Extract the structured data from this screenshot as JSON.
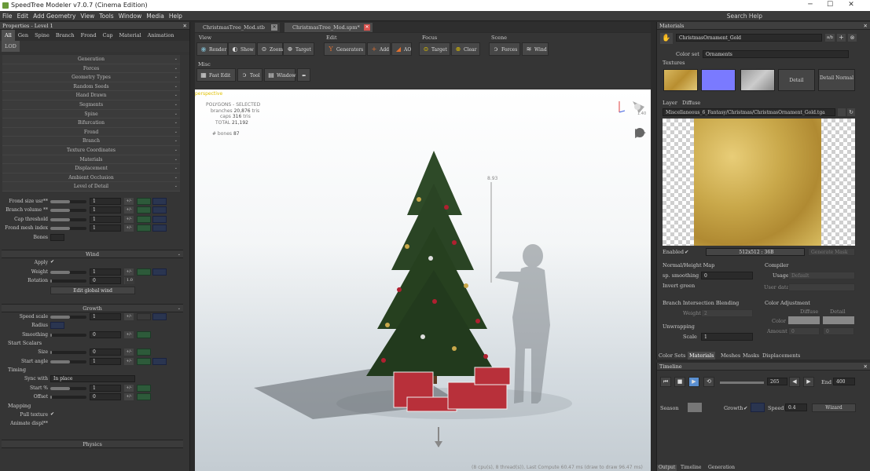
{
  "window": {
    "title": "SpeedTree Modeler v7.0.7 (Cinema Edition)",
    "min": "─",
    "max": "☐",
    "close": "✕"
  },
  "menu": [
    "File",
    "Edit",
    "Add Geometry",
    "View",
    "Tools",
    "Window",
    "Media",
    "Help"
  ],
  "search_help": "Search Help",
  "properties": {
    "title": "Properties - Level 1",
    "tabs": [
      "All",
      "Gen",
      "Spine",
      "Branch",
      "Frond",
      "Cap",
      "Material",
      "Animation"
    ],
    "lod_tab": "LOD",
    "sections": [
      "Generation",
      "Forces",
      "Geometry Types",
      "Random Seeds",
      "Hand Drawn",
      "Segments",
      "Spine",
      "Bifurcation",
      "Frond",
      "Branch",
      "Texture Coordinates",
      "Materials",
      "Displacement",
      "Ambient Occlusion",
      "Level of Detail"
    ],
    "lod_rows": [
      {
        "label": "Frond size usr**",
        "value": "1"
      },
      {
        "label": "Branch volume **",
        "value": "1"
      },
      {
        "label": "Cap threshold",
        "value": "1"
      },
      {
        "label": "Frond mesh index",
        "value": "1"
      }
    ],
    "bones_label": "Bones",
    "wind": {
      "header": "Wind",
      "apply_label": "Apply",
      "apply_check": "✔",
      "weight_label": "Weight",
      "weight": "1",
      "rotation_label": "Rotation",
      "rotation": "0",
      "rotation_max": "1.0",
      "edit_button": "Edit global wind"
    },
    "growth": {
      "header": "Growth",
      "speed_label": "Speed scale",
      "speed": "1",
      "radius_label": "Radius",
      "smoothing_label": "Smoothing",
      "smoothing": "0",
      "start_scalars": "Start Scalars",
      "size_label": "Size",
      "size": "0",
      "angle_label": "Start angle",
      "angle": "1",
      "timing": "Timing",
      "sync_label": "Sync with",
      "sync_value": "In place",
      "startk_label": "Start %",
      "startk": "1",
      "offset_label": "Offset",
      "offset": "0",
      "mapping": "Mapping",
      "pull_label": "Pull texture",
      "pull_check": "✔",
      "animate_label": "Animate displ**"
    },
    "physics": "Physics"
  },
  "doc_tabs": [
    {
      "label": "ChristmasTree_Mod.stb",
      "close": "✕"
    },
    {
      "label": "ChristmasTree_Mod.spm*",
      "close": "✕"
    }
  ],
  "toolbar": {
    "groups": [
      "View",
      "Edit",
      "Focus",
      "Scene",
      "Misc"
    ],
    "view": [
      "Render",
      "Show",
      "Zoom",
      "Target"
    ],
    "edit": [
      "Generators",
      "Add",
      "AO"
    ],
    "focus": [
      "Target",
      "Clear"
    ],
    "scene": [
      "Forces",
      "Wind"
    ],
    "misc": [
      "Fast Edit",
      "Tool",
      "Window"
    ],
    "back": "⬅"
  },
  "viewport": {
    "label": "perspective",
    "polygons_label": "POLYGONS - SELECTED",
    "branches_label": "branches",
    "branches": "20,876",
    "branches_unit": "tris",
    "caps_label": "caps",
    "caps": "316",
    "caps_unit": "tris",
    "total_label": "TOTAL",
    "total": "21,192",
    "bones_label": "# bones",
    "bones": "87",
    "height_label": "8.93",
    "light_label": "1.40",
    "status": "(8 cpu(s), 8 thread(s)), Last Compute 60.47 ms (draw to draw 96.47 ms)"
  },
  "materials": {
    "title": "Materials",
    "name": "ChristmasOrnament_Gold",
    "color_set_label": "Color set",
    "color_set": "Ornaments",
    "textures_label": "Textures",
    "detail_btn": "Detail",
    "detail_normal_btn": "Detail Normal",
    "layer_label": "Layer",
    "layer_value": "Diffuse",
    "path": "Miscellaneous_6_Fantasy/Christmas/ChristmasOrnament_Gold.tga",
    "enabled_label": "Enabled",
    "enabled_check": "✔",
    "res": "512x512 : 36B",
    "gen_mask": "Generate Mask",
    "normal_header": "Normal/Height Map",
    "smoothing_label": "sp. smoothing",
    "smoothing": "0",
    "invert_label": "Invert green",
    "compiler_header": "Compiler",
    "usage_label": "Usage",
    "usage": "Default",
    "user_data_label": "User data",
    "bib_header": "Branch Intersection Blending",
    "bib_weight_label": "Weight",
    "bib_weight": "2",
    "ca_header": "Color Adjustment",
    "diffuse_label": "Diffuse",
    "detail_label": "Detail",
    "color_label": "Color",
    "amount_label": "Amount",
    "amount1": "0",
    "amount2": "0",
    "unwrapping": "Unwrapping",
    "scale_label": "Scale",
    "scale": "1",
    "bottom_tabs": [
      "Color Sets",
      "Materials",
      "Meshes",
      "Masks",
      "Displacements"
    ]
  },
  "timeline": {
    "title": "Timeline",
    "frame": "265",
    "end_label": "End",
    "end": "400",
    "season_label": "Season",
    "growth_label": "Growth",
    "growth_check": "✔",
    "speed_label": "Speed",
    "speed": "0.4",
    "wizard": "Wizard",
    "tabs": [
      "Output",
      "Timeline",
      "Generation"
    ]
  },
  "colors": {
    "accent": "#5a8fd0",
    "gold": "#c9a84a",
    "green": "#2d5a3a"
  }
}
